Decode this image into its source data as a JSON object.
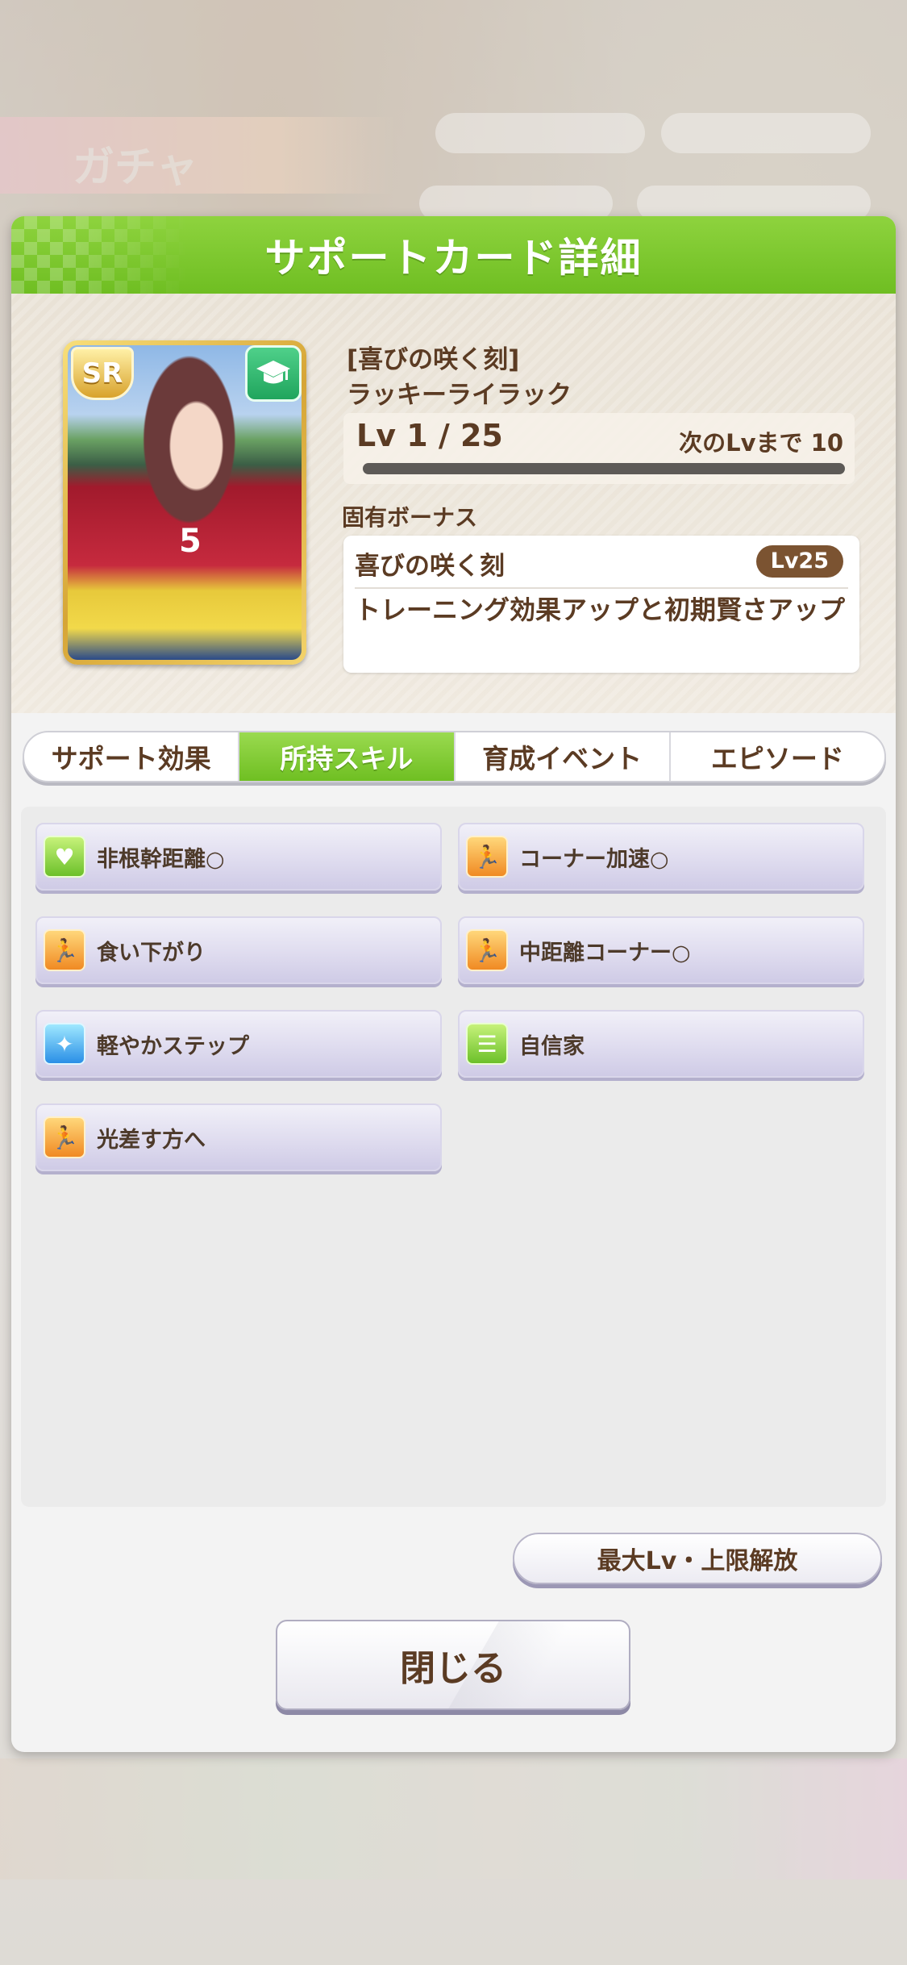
{
  "background": {
    "banner_text": "ガチャ"
  },
  "dialog": {
    "title": "サポートカード詳細",
    "card": {
      "rarity": "SR",
      "type_icon": "graduation-cap-icon",
      "jersey_number": "5",
      "title": "[喜びの咲く刻]",
      "name": "ラッキーライラック"
    },
    "level": {
      "text": "Lv 1 / 25",
      "next_label": "次のLvまで 10",
      "progress": 0
    },
    "bonus": {
      "label": "固有ボーナス",
      "name": "喜びの咲く刻",
      "level": "Lv25",
      "description": "トレーニング効果アップと初期賢さアップ"
    },
    "tabs": [
      {
        "label": "サポート効果",
        "active": false
      },
      {
        "label": "所持スキル",
        "active": true
      },
      {
        "label": "育成イベント",
        "active": false
      },
      {
        "label": "エピソード",
        "active": false
      }
    ],
    "skills": [
      {
        "label": "非根幹距離○",
        "icon": "heart-icon",
        "color": "green"
      },
      {
        "label": "コーナー加速○",
        "icon": "runner-icon",
        "color": "orange"
      },
      {
        "label": "食い下がり",
        "icon": "runner-icon",
        "color": "orange"
      },
      {
        "label": "中距離コーナー○",
        "icon": "runner-icon",
        "color": "orange"
      },
      {
        "label": "軽やかステップ",
        "icon": "sparkle-icon",
        "color": "blue"
      },
      {
        "label": "自信家",
        "icon": "list-icon",
        "color": "green"
      },
      {
        "label": "光差す方へ",
        "icon": "runner-icon",
        "color": "orange"
      }
    ],
    "buttons": {
      "limit_break": "最大Lv・上限解放",
      "close": "閉じる"
    }
  }
}
